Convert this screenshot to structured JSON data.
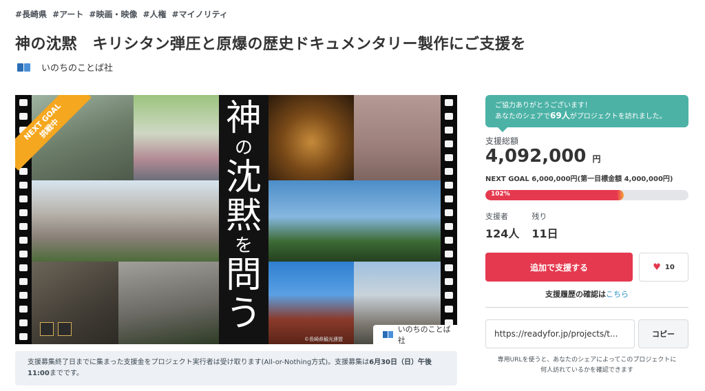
{
  "tags": [
    "#長崎県",
    "#アート",
    "#映画・映像",
    "#人権",
    "#マイノリティ"
  ],
  "title": "神の沈黙　キリシタン弾圧と原爆の歴史ドキュメンタリー製作にご支援を",
  "owner": {
    "name": "いのちのことば社"
  },
  "hero": {
    "vertical_title_big1": "神",
    "vertical_title_small1": "の",
    "vertical_title_big2": "沈",
    "vertical_title_big3": "黙",
    "vertical_title_small2": "を",
    "vertical_title_big4": "問",
    "vertical_title_big5": "う",
    "ribbon_line1": "NEXT GOAL",
    "ribbon_line2": "挑戦中",
    "logo_text": "いのちのことば社",
    "credit": "©長崎県観光連盟"
  },
  "notice": {
    "text1": "支援募集終了日までに集まった支援金をプロジェクト実行者は受け取ります(All-or-Nothing方式)。支援募集は",
    "deadline": "6月30日（日）午後11:00",
    "text2": "までです。"
  },
  "share_bubble": {
    "line1": "ご協力ありがとうございます！",
    "line2_pre": "あなたのシェアで",
    "count": "69人",
    "line2_post": "がプロジェクトを訪れました。"
  },
  "funding": {
    "total_label": "支援総額",
    "total": "4,092,000",
    "currency": "円",
    "next_goal": "NEXT GOAL 6,000,000円(第一目標金額 4,000,000円)",
    "progress_label": "102%",
    "progress_fraction": 0.68,
    "supporters_label": "支援者",
    "supporters": "124人",
    "remaining_label": "残り",
    "remaining": "11日"
  },
  "actions": {
    "support_button": "追加で支援する",
    "like_count": "10",
    "history_text": "支援履歴の確認は",
    "history_link": "こちら"
  },
  "share": {
    "url": "https://readyfor.jp/projects/t...",
    "copy_button": "コピー",
    "note": "専用URLを使うと、あなたのシェアによってこのプロジェクトに何人訪れているかを確認できます"
  },
  "colors": {
    "accent_red": "#e5394f",
    "bubble_teal": "#4cb2a6",
    "ribbon_orange": "#f5a71f",
    "link_blue": "#2f8fc6"
  }
}
